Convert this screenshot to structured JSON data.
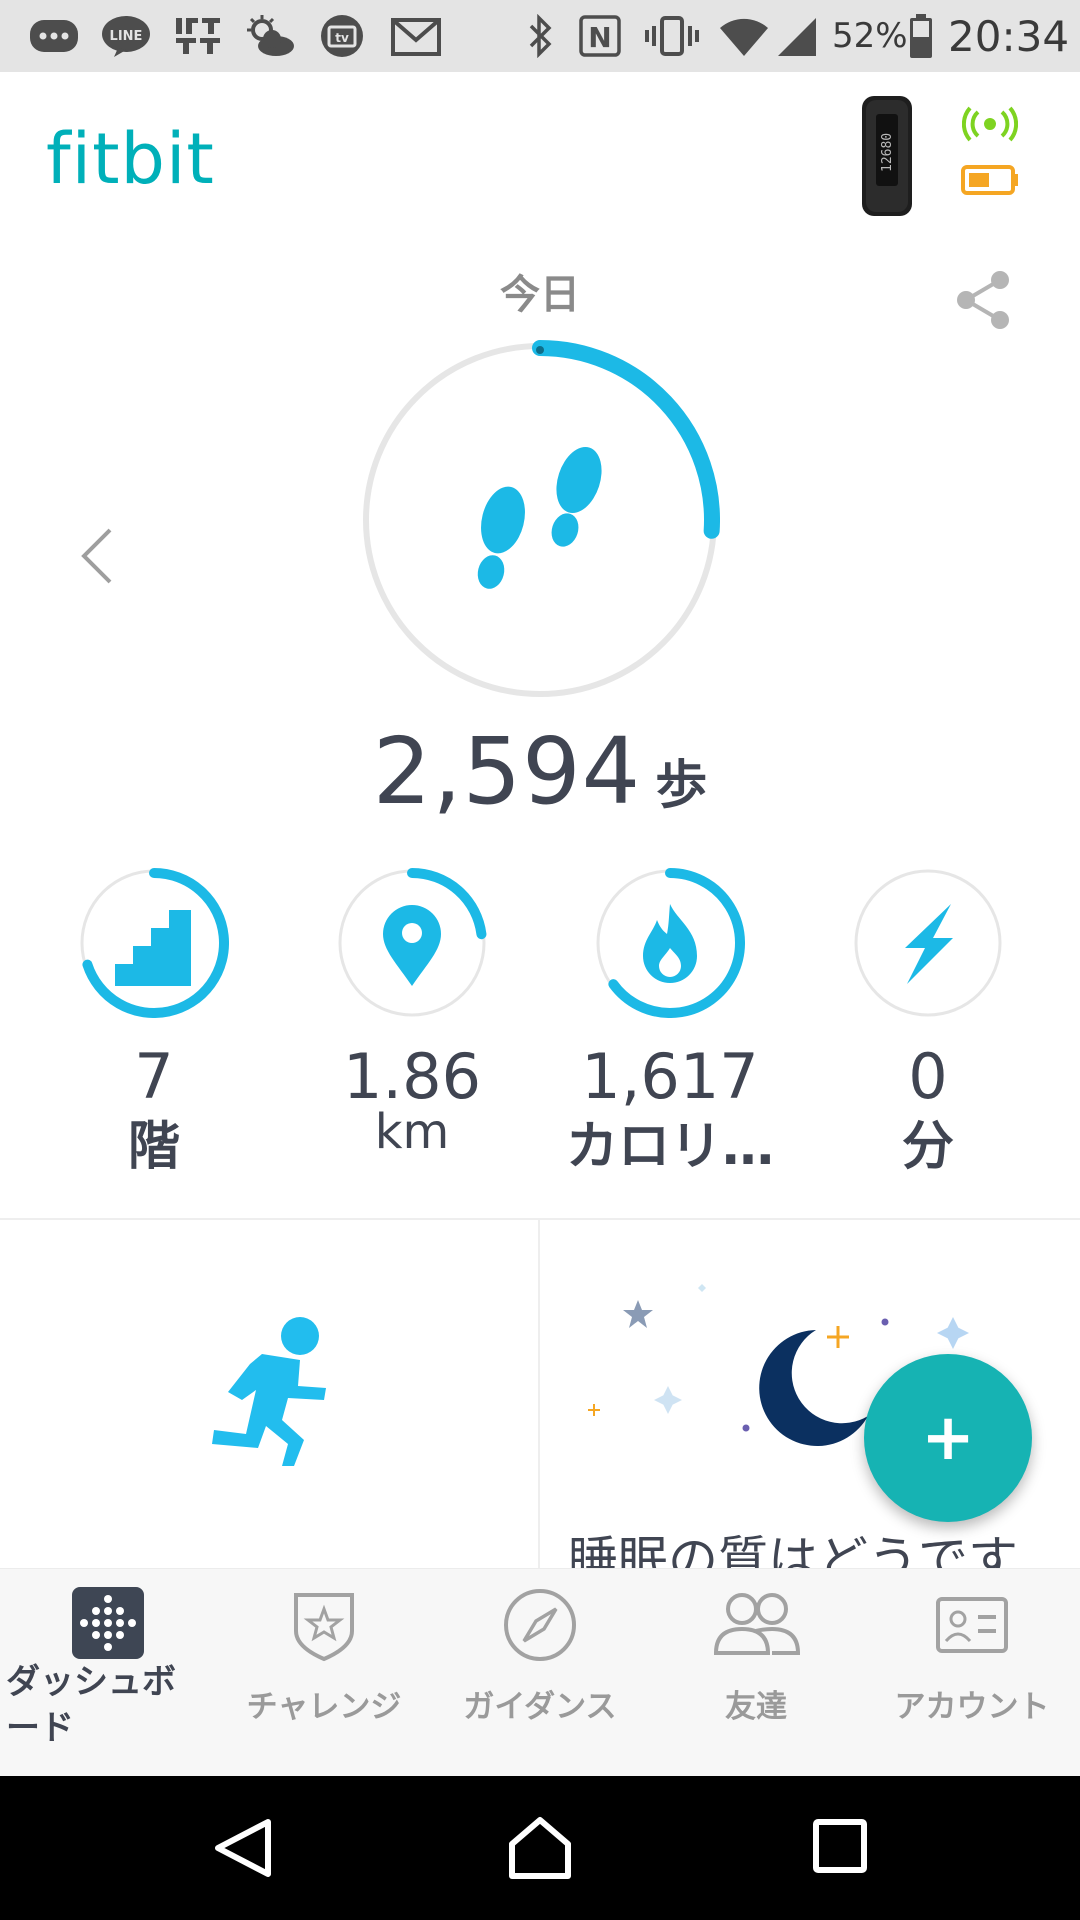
{
  "status_bar": {
    "battery_percent": "52%",
    "time": "20:34",
    "line_label": "LINE",
    "ifttt_label": "IFTTT",
    "nfc_label": "N",
    "tv_label": "tv"
  },
  "header": {
    "logo": "fitbit",
    "tracker_display": "12680",
    "sync_color": "#7ed321",
    "battery_color": "#f5a623"
  },
  "today": {
    "label": "今日",
    "steps_value": "2,594",
    "steps_unit": "歩",
    "steps_progress": 0.26
  },
  "stats": [
    {
      "name": "floors",
      "value": "7",
      "unit": "階",
      "progress": 0.7
    },
    {
      "name": "distance",
      "value": "1.86",
      "unit": "km",
      "progress": 0.23
    },
    {
      "name": "calories",
      "value": "1,617",
      "unit": "カロリ…",
      "progress": 0.65
    },
    {
      "name": "active-minutes",
      "value": "0",
      "unit": "分",
      "progress": 0.0
    }
  ],
  "tiles": {
    "sleep_text": "睡眠の質はどうです"
  },
  "fab": {
    "label": "+"
  },
  "bottom_nav": [
    {
      "label": "ダッシュボード",
      "active": true
    },
    {
      "label": "チャレンジ",
      "active": false
    },
    {
      "label": "ガイダンス",
      "active": false
    },
    {
      "label": "友達",
      "active": false
    },
    {
      "label": "アカウント",
      "active": false
    }
  ],
  "colors": {
    "accent": "#00b0b9",
    "progress": "#1cb9e6",
    "ring_track": "#e6e6e6",
    "text": "#404552"
  }
}
